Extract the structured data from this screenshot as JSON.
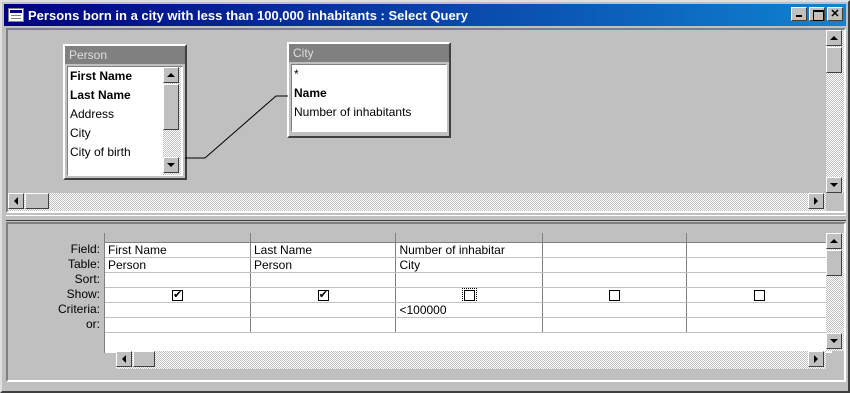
{
  "window": {
    "title": "Persons born in a city with less than 100,000 inhabitants : Select Query"
  },
  "tables": {
    "person": {
      "title": "Person",
      "fields": [
        {
          "name": "First Name",
          "bold": true
        },
        {
          "name": "Last Name",
          "bold": true
        },
        {
          "name": "Address",
          "bold": false
        },
        {
          "name": "City",
          "bold": false
        },
        {
          "name": "City of birth",
          "bold": false
        }
      ]
    },
    "city": {
      "title": "City",
      "fields": [
        {
          "name": "*",
          "bold": false
        },
        {
          "name": "Name",
          "bold": true
        },
        {
          "name": "Number of inhabitants",
          "bold": false
        }
      ]
    }
  },
  "grid": {
    "row_labels": [
      "Field:",
      "Table:",
      "Sort:",
      "Show:",
      "Criteria:",
      "or:"
    ],
    "columns": [
      {
        "field": "First Name",
        "table": "Person",
        "sort": "",
        "show": true,
        "criteria": "",
        "or": ""
      },
      {
        "field": "Last Name",
        "table": "Person",
        "sort": "",
        "show": true,
        "criteria": "",
        "or": ""
      },
      {
        "field": "Number of inhabitar",
        "table": "City",
        "sort": "",
        "show": false,
        "criteria": "<100000",
        "or": ""
      },
      {
        "field": "",
        "table": "",
        "sort": "",
        "show": false,
        "criteria": "",
        "or": ""
      },
      {
        "field": "",
        "table": "",
        "sort": "",
        "show": false,
        "criteria": "",
        "or": ""
      }
    ]
  },
  "colors": {
    "titlebar_start": "#000080",
    "titlebar_end": "#1084d0",
    "face": "#c0c0c0",
    "inactive_caption": "#808080"
  }
}
